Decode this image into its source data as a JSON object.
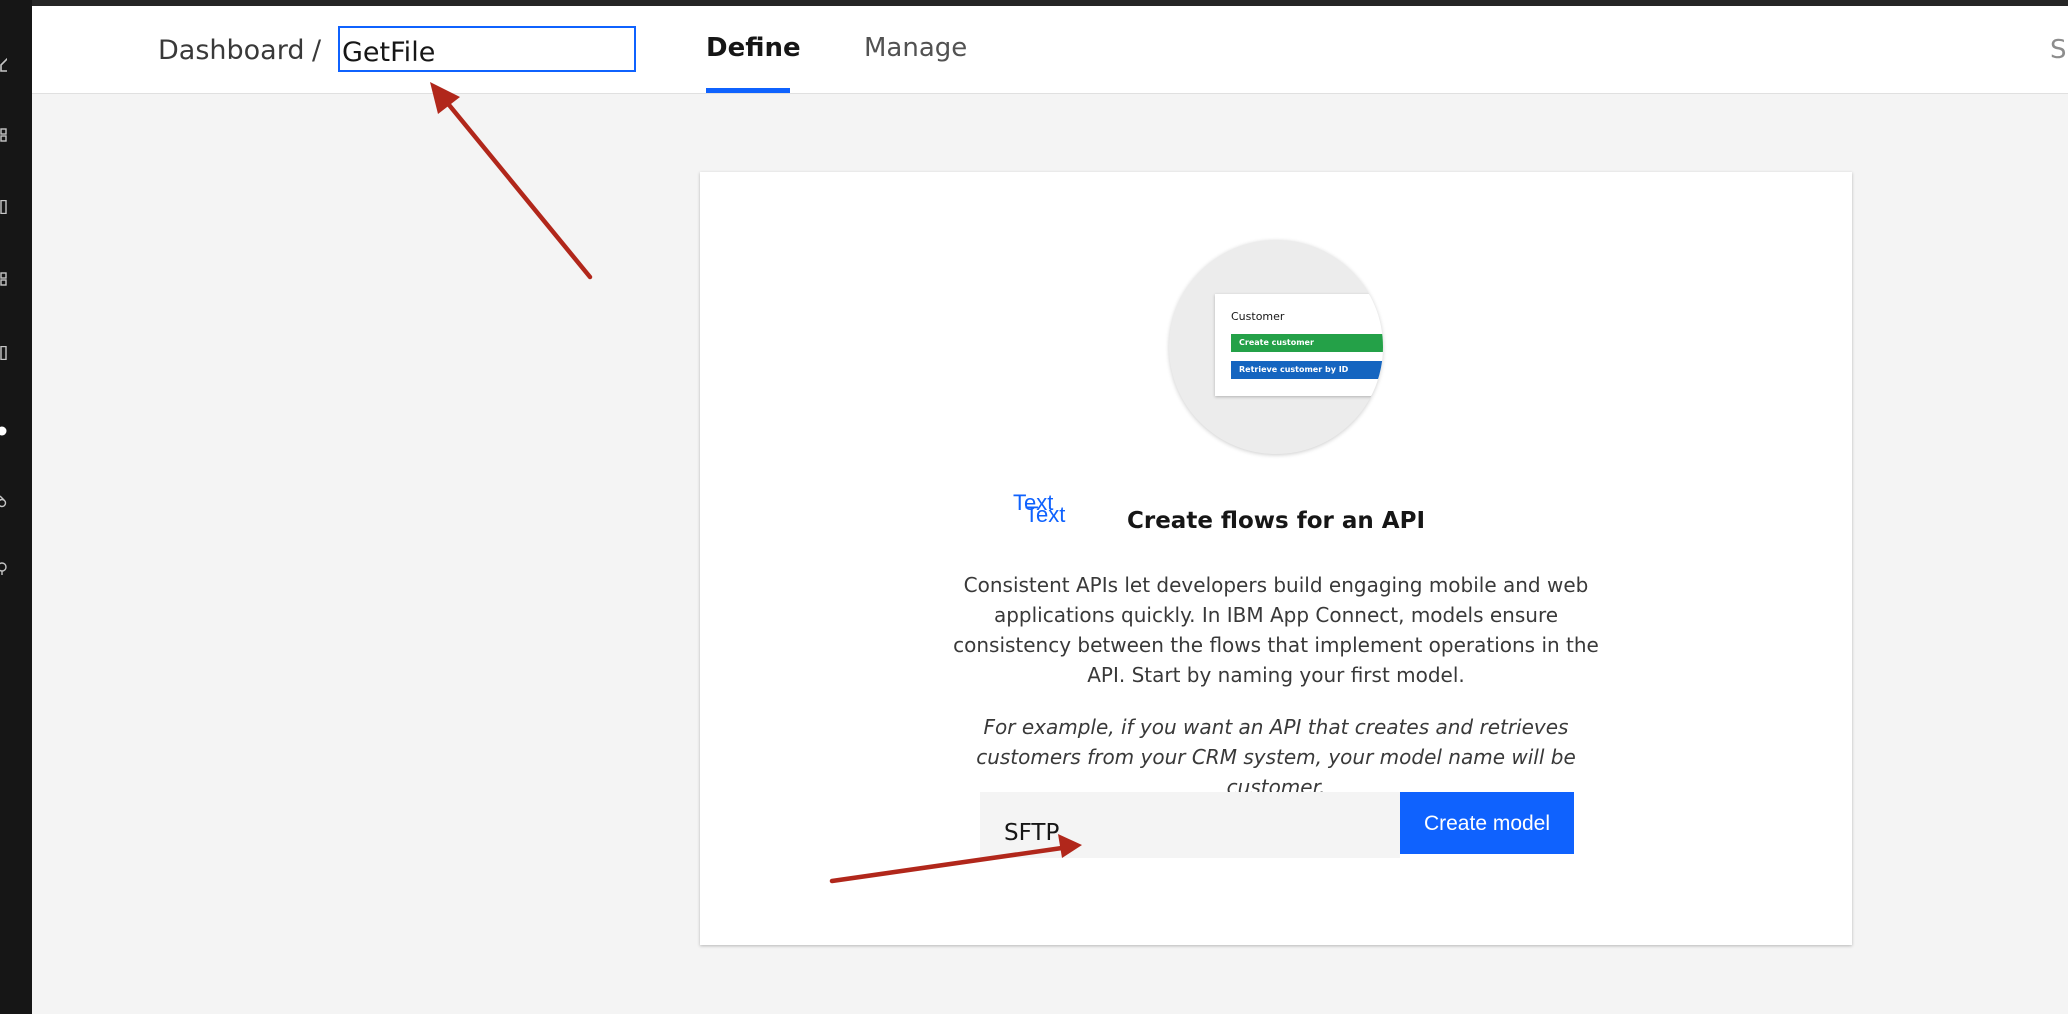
{
  "breadcrumb": {
    "dashboard_label": "Dashboard",
    "separator": "/",
    "flow_name_value": "GetFile"
  },
  "tabs": [
    {
      "label": "Define",
      "active": true
    },
    {
      "label": "Manage",
      "active": false
    }
  ],
  "header_right_text": "S",
  "sidebar_icons": [
    "home-icon",
    "grid-icon",
    "document-icon",
    "apps-icon",
    "file-icon",
    "dot-icon",
    "flow-icon",
    "help-icon"
  ],
  "illustration": {
    "title": "Customer",
    "create_button": "Create customer",
    "retrieve_button": "Retrieve customer by ID"
  },
  "overlay_text": [
    "Text",
    "Text"
  ],
  "card": {
    "title": "Create flows for an API",
    "description": "Consistent APIs let developers build engaging mobile and web applications quickly. In IBM App Connect, models ensure consistency between the flows that implement operations in the API. Start by naming your first model.",
    "example": "For example, if you want an API that creates and retrieves customers from your CRM system, your model name will be customer.",
    "model_name_value": "SFTP",
    "create_button_label": "Create model"
  },
  "colors": {
    "accent": "#0f62fe",
    "annotation_arrow": "#b1271b",
    "mini_create": "#24a148",
    "mini_retrieve": "#1565c0",
    "sidebar": "#161616"
  }
}
